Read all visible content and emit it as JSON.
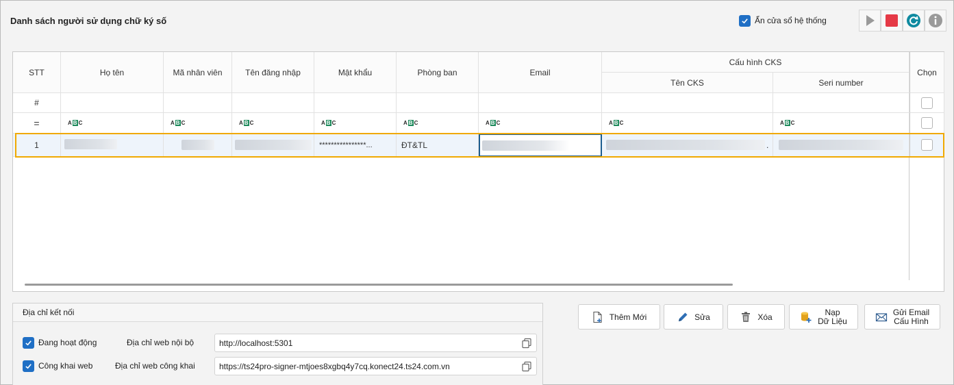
{
  "header": {
    "title": "Danh sách người sử dụng chữ ký số",
    "hide_system_window_label": "Ẩn cửa sổ hệ thống",
    "hide_system_window_checked": true
  },
  "toolbar": {
    "icons": [
      "play-icon",
      "stop-icon",
      "refresh-icon",
      "info-icon"
    ],
    "colors": {
      "play": "#9a9a9a",
      "stop": "#e53946",
      "refresh": "#0f8aa0",
      "info": "#9a9a9a"
    }
  },
  "grid": {
    "columns": {
      "stt": "STT",
      "ho_ten": "Họ tên",
      "ma_nhan_vien": "Mã nhân viên",
      "ten_dang_nhap": "Tên đăng nhập",
      "mat_khau": "Mật khẩu",
      "phong_ban": "Phòng ban",
      "email": "Email",
      "cau_hinh_cks": "Cấu hình CKS",
      "ten_cks": "Tên CKS",
      "seri_number": "Seri number",
      "chon": "Chọn"
    },
    "hash_row_label": "#",
    "filter_row_label": "=",
    "filter_type_label": "ABC",
    "rows": [
      {
        "stt": "1",
        "mat_khau": "****************...",
        "phong_ban": "ĐT&TL",
        "ten_cks_suffix": "."
      }
    ]
  },
  "connection": {
    "title": "Địa chỉ kết nối",
    "active_label": "Đang hoạt động",
    "active_checked": true,
    "public_label": "Công khai web",
    "public_checked": true,
    "local_web_label": "Địa chỉ web nội bộ",
    "local_web_value": "http://localhost:5301",
    "public_web_label": "Địa chỉ web công khai",
    "public_web_value": "https://ts24pro-signer-mtjoes8xgbq4y7cq.konect24.ts24.com.vn"
  },
  "actions": {
    "add": "Thêm Mới",
    "edit": "Sửa",
    "delete": "Xóa",
    "load_line1": "Nạp",
    "load_line2": "Dữ Liệu",
    "send_line1": "Gửi Email",
    "send_line2": "Cấu Hình"
  },
  "accent_color": "#1f6fc5",
  "selection_color": "#f0a900"
}
